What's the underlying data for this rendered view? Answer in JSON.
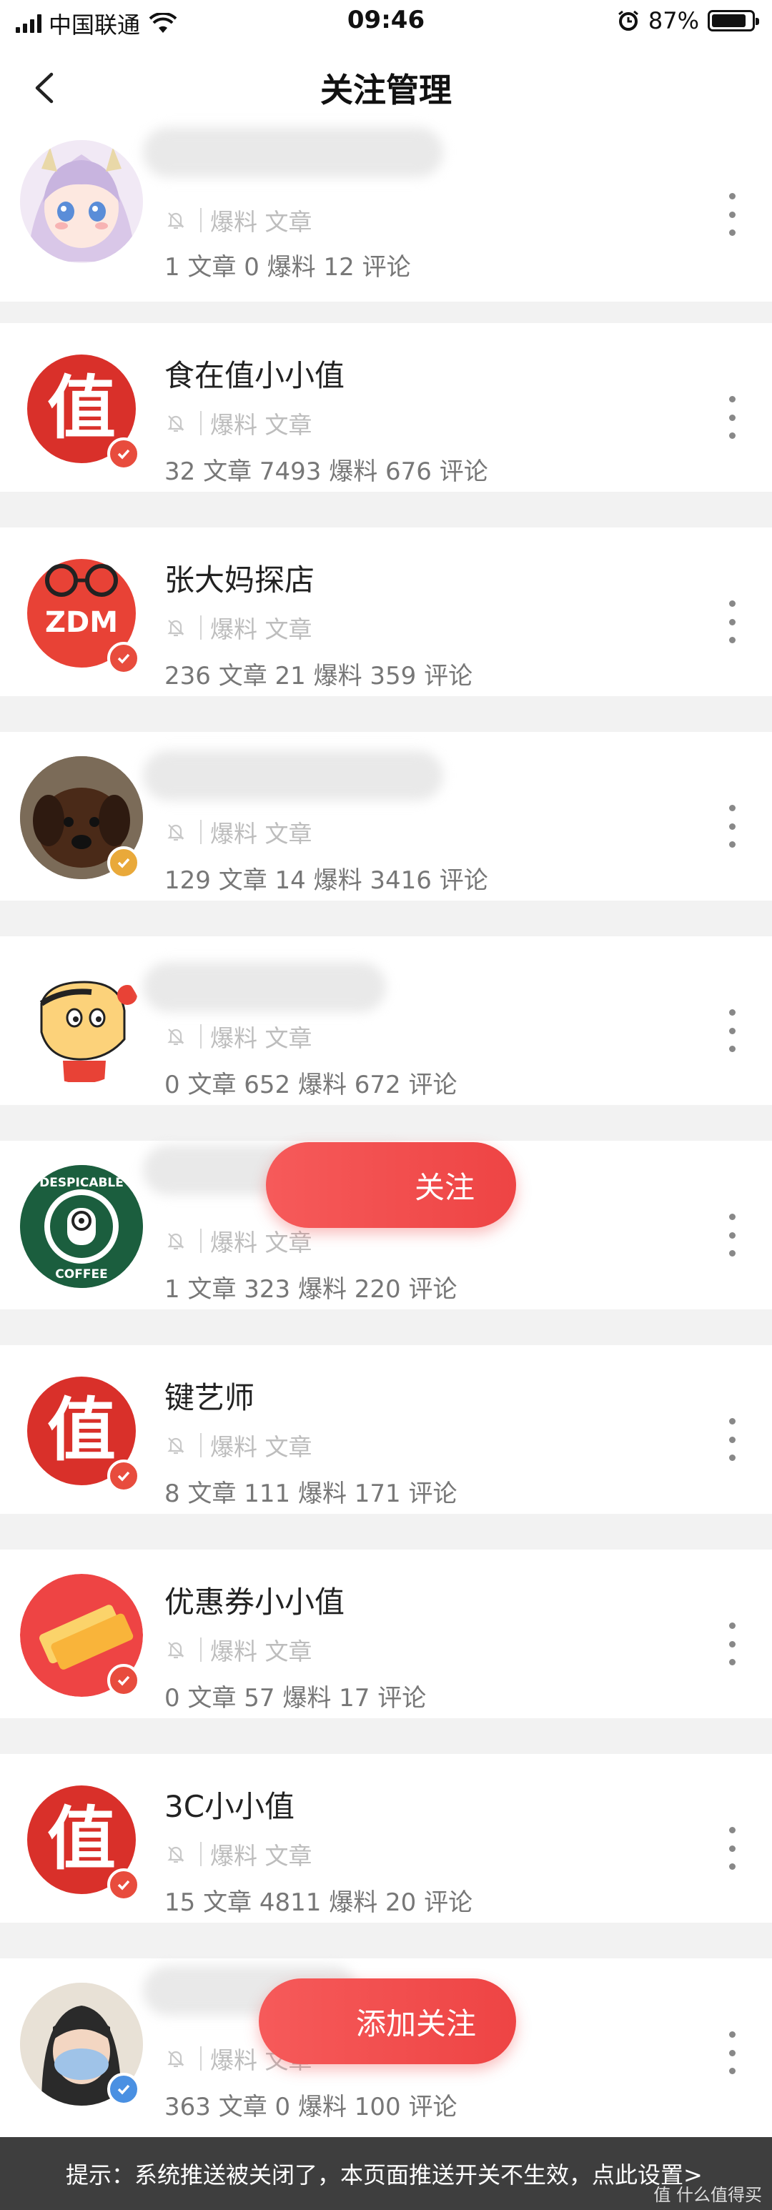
{
  "status_bar": {
    "carrier": "中国联通",
    "time": "09:46",
    "battery": "87%",
    "battery_level": 0.87
  },
  "header": {
    "title": "关注管理"
  },
  "labels": {
    "tags": "爆料 文章"
  },
  "items": [
    {
      "name": "",
      "name_visible": false,
      "avatar": "anime-girl-avatar",
      "badge": "none",
      "stats": "1 文章  0 爆料  12 评论"
    },
    {
      "name": "食在值小小值",
      "name_visible": true,
      "avatar": "zhi-logo-avatar",
      "badge": "red-verified",
      "stats": "32 文章  7493 爆料  676 评论"
    },
    {
      "name": "张大妈探店",
      "name_visible": true,
      "avatar": "zdm-glasses-avatar",
      "badge": "red-verified",
      "stats": "236 文章  21 爆料  359 评论"
    },
    {
      "name": "",
      "name_visible": false,
      "avatar": "puppy-avatar",
      "badge": "gold-verified",
      "stats": "129 文章  14 爆料  3416 评论"
    },
    {
      "name": "",
      "name_visible": false,
      "avatar": "crayon-shin-avatar",
      "badge": "none",
      "stats": "0 文章  652 爆料  672 评论"
    },
    {
      "name": "",
      "name_visible": false,
      "avatar": "despicable-coffee-avatar",
      "badge": "none",
      "stats": "1 文章  323 爆料  220 评论"
    },
    {
      "name": "键艺师",
      "name_visible": true,
      "avatar": "zhi-logo-avatar",
      "badge": "red-verified",
      "stats": "8 文章  111 爆料  171 评论"
    },
    {
      "name": "优惠券小小值",
      "name_visible": true,
      "avatar": "coupon-avatar",
      "badge": "red-verified",
      "stats": "0 文章  57 爆料  17 评论"
    },
    {
      "name": "3C小小值",
      "name_visible": true,
      "avatar": "zhi-logo-avatar",
      "badge": "red-verified",
      "stats": "15 文章  4811 爆料  20 评论"
    },
    {
      "name": "",
      "name_visible": false,
      "avatar": "girl-mask-avatar",
      "badge": "blue-verified",
      "stats": "363 文章  0 爆料  100 评论"
    }
  ],
  "floating_buttons": {
    "follow_1": "关注",
    "follow_2": "添加关注"
  },
  "banner": {
    "text": "提示：系统推送被关闭了，本页面推送开关不生效，点此设置>",
    "watermark": "值 什么值得买"
  },
  "colors": {
    "accent": "#ee4444",
    "badge_red": "#e84c3d",
    "badge_gold": "#e9a93a",
    "badge_blue": "#4a90e2"
  }
}
